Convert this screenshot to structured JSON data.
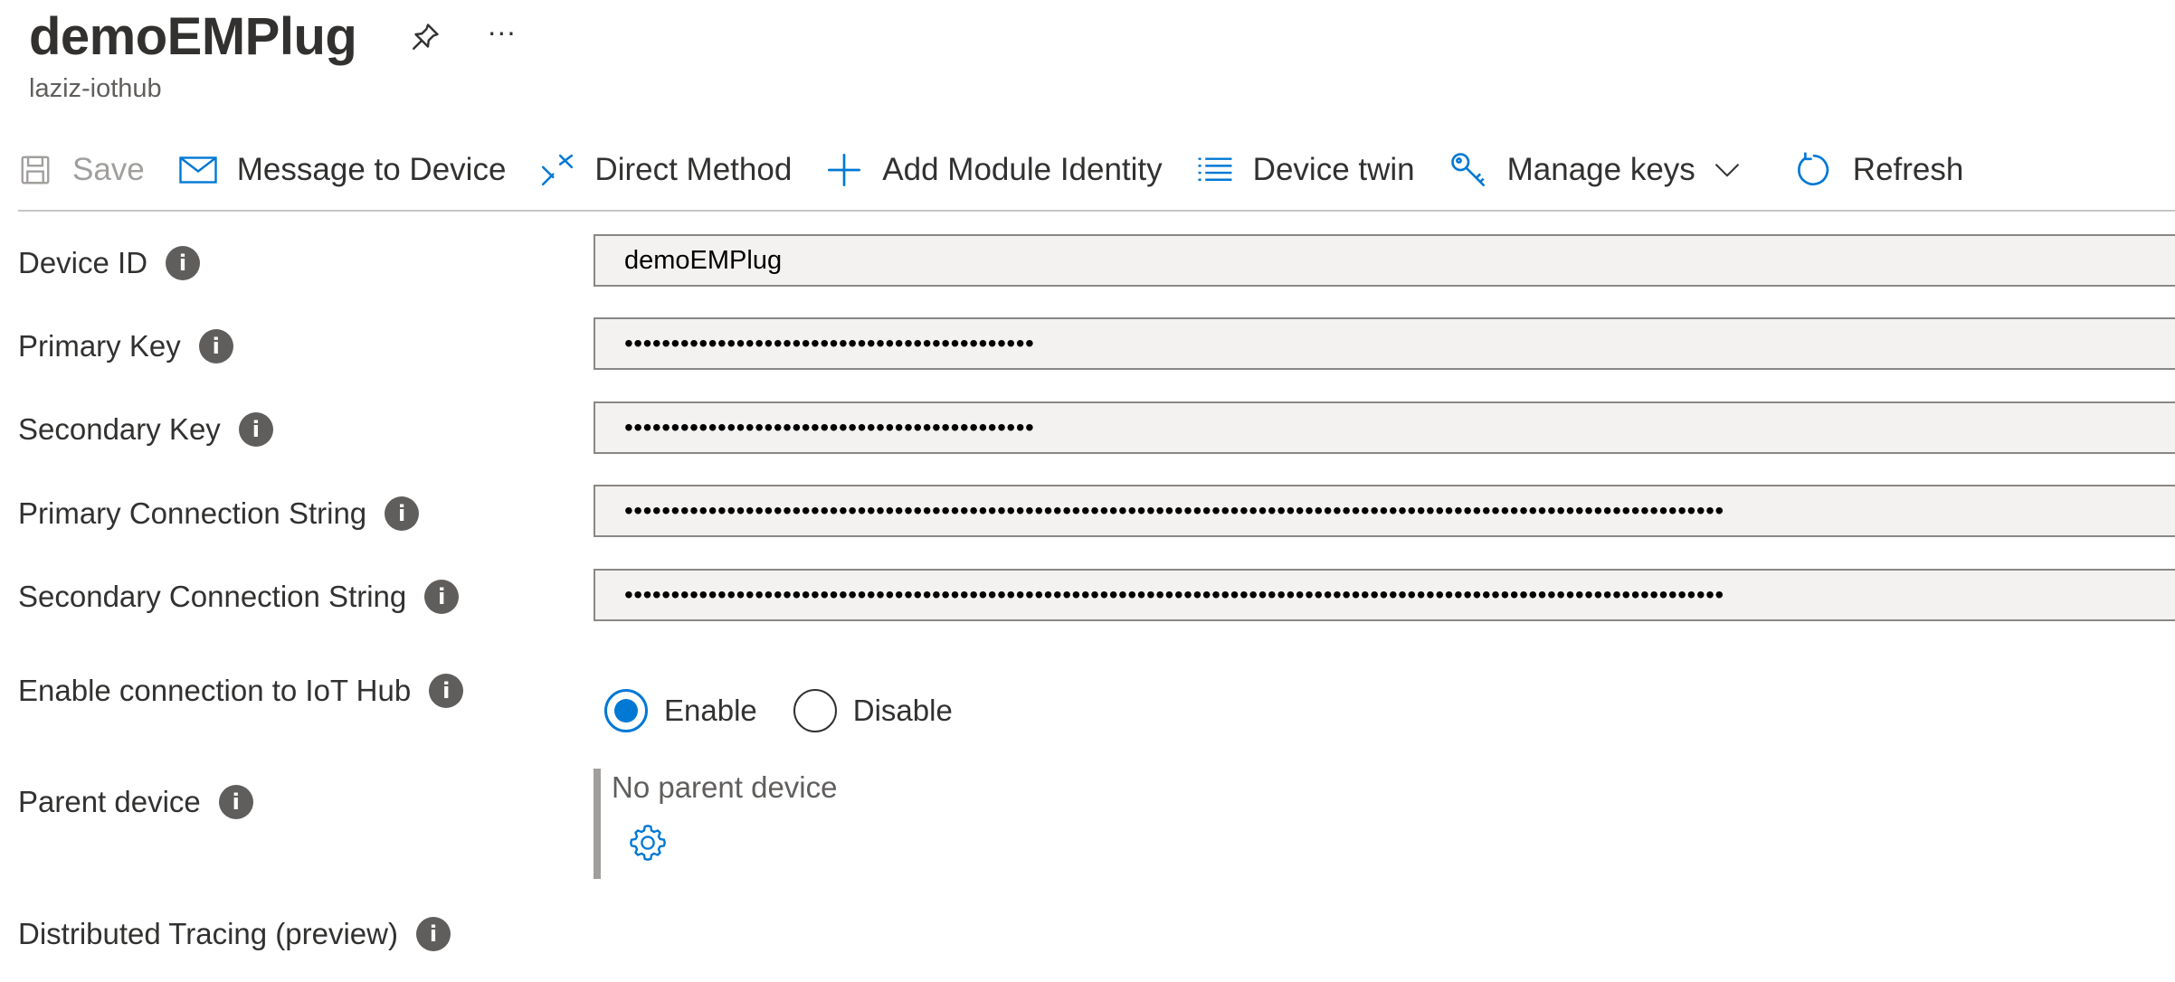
{
  "header": {
    "title": "demoEMPlug",
    "subtitle": "laziz-iothub",
    "more_label": "···"
  },
  "toolbar": {
    "save_label": "Save",
    "message_label": "Message to Device",
    "direct_method_label": "Direct Method",
    "add_module_label": "Add Module Identity",
    "device_twin_label": "Device twin",
    "manage_keys_label": "Manage keys",
    "refresh_label": "Refresh"
  },
  "fields": {
    "device_id": {
      "label": "Device ID",
      "value": "demoEMPlug"
    },
    "primary_key": {
      "label": "Primary Key",
      "value": "••••••••••••••••••••••••••••••••••••••••••••"
    },
    "secondary_key": {
      "label": "Secondary Key",
      "value": "••••••••••••••••••••••••••••••••••••••••••••"
    },
    "primary_conn": {
      "label": "Primary Connection String",
      "value": "••••••••••••••••••••••••••••••••••••••••••••••••••••••••••••••••••••••••••••••••••••••••••••••••••••••••••••••••••••••"
    },
    "secondary_conn": {
      "label": "Secondary Connection String",
      "value": "••••••••••••••••••••••••••••••••••••••••••••••••••••••••••••••••••••••••••••••••••••••••••••••••••••••••••••••••••••••"
    }
  },
  "connection": {
    "label": "Enable connection to IoT Hub",
    "enable_label": "Enable",
    "disable_label": "Disable",
    "selected": "Enable"
  },
  "parent": {
    "label": "Parent device",
    "value": "No parent device"
  },
  "tracing": {
    "label": "Distributed Tracing (preview)"
  },
  "info_glyph": "i",
  "colors": {
    "accent": "#0078d4",
    "text": "#323130",
    "muted": "#a19f9d",
    "field_bg": "#f3f2f1"
  }
}
